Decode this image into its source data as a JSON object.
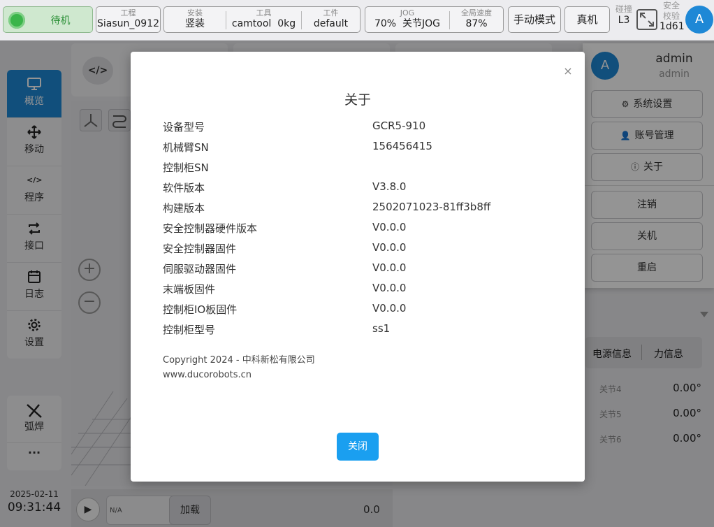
{
  "topbar": {
    "status": "待机",
    "project": {
      "label": "工程",
      "value": "Siasun_0912"
    },
    "mount": {
      "label": "安装",
      "value": "竖装"
    },
    "tool": {
      "label": "工具",
      "name": "camtool",
      "weight": "0kg"
    },
    "workpiece": {
      "label": "工件",
      "value": "default"
    },
    "jog": {
      "label": "JOG",
      "percent": "70%",
      "mode": "关节JOG"
    },
    "global_speed": {
      "label": "全局速度",
      "value": "87%"
    },
    "manual_mode": "手动模式",
    "real_machine": "真机",
    "collision": {
      "label": "碰撞",
      "value": "L3"
    },
    "safety_check": {
      "label1": "安全",
      "label2": "校验",
      "value": "1d61"
    },
    "avatar_letter": "A"
  },
  "nav": {
    "items": [
      {
        "label": "概览",
        "icon": "monitor-icon"
      },
      {
        "label": "移动",
        "icon": "move-icon"
      },
      {
        "label": "程序",
        "icon": "code-icon"
      },
      {
        "label": "接口",
        "icon": "interface-icon"
      },
      {
        "label": "日志",
        "icon": "calendar-icon"
      },
      {
        "label": "设置",
        "icon": "gear-icon"
      }
    ],
    "weld_label": "弧焊",
    "more": "···"
  },
  "clock": {
    "date": "2025-02-11",
    "time": "09:31:44"
  },
  "workspace": {
    "code_glyph": "</>",
    "program_placeholder": "N/A",
    "load_button": "加载",
    "speed_value": "0.0"
  },
  "right_panel": {
    "tabs": [
      "电源信息",
      "力信息"
    ],
    "joints": [
      {
        "name": "关节4",
        "value": "0.00°"
      },
      {
        "name": "关节5",
        "value": "0.00°"
      },
      {
        "name": "关节6",
        "value": "0.00°"
      }
    ]
  },
  "user_menu": {
    "avatar_letter": "A",
    "name": "admin",
    "role": "admin",
    "buttons": [
      "系统设置",
      "账号管理",
      "关于",
      "注销",
      "关机",
      "重启"
    ]
  },
  "about_dialog": {
    "title": "关于",
    "close_glyph": "×",
    "rows": [
      {
        "key": "设备型号",
        "value": "GCR5-910"
      },
      {
        "key": "机械臂SN",
        "value": "156456415"
      },
      {
        "key": "控制柜SN",
        "value": ""
      },
      {
        "key": "软件版本",
        "value": "V3.8.0"
      },
      {
        "key": "构建版本",
        "value": "2502071023-81ff3b8ff"
      },
      {
        "key": "安全控制器硬件版本",
        "value": "V0.0.0"
      },
      {
        "key": "安全控制器固件",
        "value": "V0.0.0"
      },
      {
        "key": "伺服驱动器固件",
        "value": "V0.0.0"
      },
      {
        "key": "末端板固件",
        "value": "V0.0.0"
      },
      {
        "key": "控制柜IO板固件",
        "value": "V0.0.0"
      },
      {
        "key": "控制柜型号",
        "value": "ss1"
      }
    ],
    "copyright": "Copyright 2024 - 中科新松有限公司",
    "website": "www.ducorobots.cn",
    "ok_button": "关闭"
  },
  "colors": {
    "accent": "#1e88d6",
    "ok_button": "#1a9ff0",
    "status_green": "#3ab54a"
  }
}
